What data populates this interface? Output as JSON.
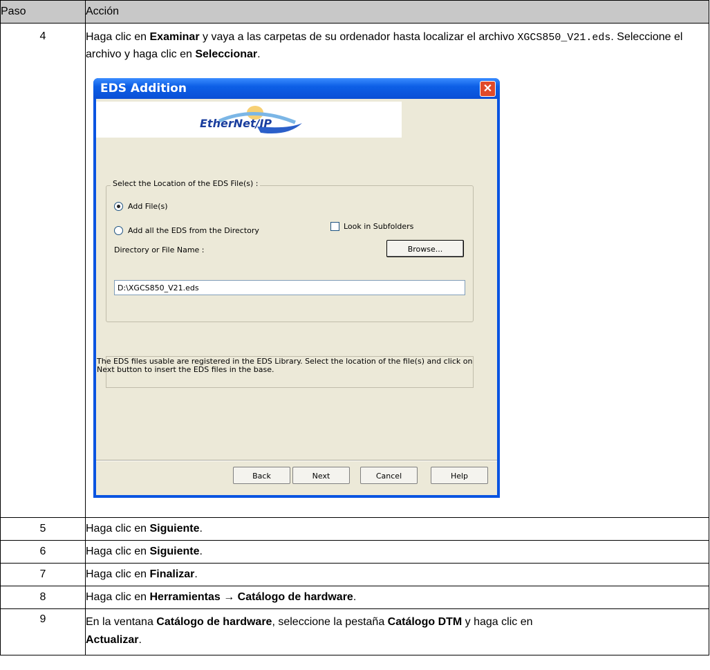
{
  "table": {
    "header": {
      "col1": "Paso",
      "col2": "Acción"
    },
    "row4": {
      "num": "4",
      "pre": "Haga clic en ",
      "b1": "Examinar",
      "mid": " y vaya a las carpetas de su ordenador hasta localizar el archivo ",
      "file": "XGCS850_V21.eds",
      "mid2": ". Seleccione el archivo y haga clic en ",
      "b2": "Seleccionar",
      "end": "."
    },
    "steps": [
      {
        "num": "5",
        "pre": "Haga clic en ",
        "bold": "Siguiente",
        "post": "."
      },
      {
        "num": "6",
        "pre": "Haga clic en ",
        "bold": "Siguiente",
        "post": "."
      },
      {
        "num": "7",
        "pre": "Haga clic en ",
        "bold": "Finalizar",
        "post": "."
      },
      {
        "num": "8",
        "pre": "Haga clic en ",
        "bold": "Herramientas → Catálogo de hardware",
        "post": "."
      }
    ],
    "row9": {
      "num": "9",
      "pre": "En la ventana ",
      "b1": "Catálogo de hardware",
      "mid": ", seleccione la pestaña ",
      "b2": "Catálogo DTM",
      "mid2": " y haga clic en ",
      "b3": "Actualizar",
      "end": "."
    }
  },
  "dialog": {
    "title": "EDS Addition",
    "close_symbol": "✕",
    "logo_text": "EtherNet/IP",
    "group_label": "Select the Location of the EDS File(s) :",
    "radio_add_files": "Add File(s)",
    "radio_add_dir": "Add all the EDS from the Directory",
    "checkbox_subfolders": "Look in Subfolders",
    "dir_label": "Directory or File Name :",
    "browse_label": "Browse...",
    "file_value": "D:\\XGCS850_V21.eds",
    "info_text": "The EDS files usable are registered in the EDS Library. Select the location of the file(s) and click on Next button to insert the EDS files in the base.",
    "buttons": {
      "back": "Back",
      "next": "Next",
      "cancel": "Cancel",
      "help": "Help"
    },
    "state": {
      "add_files_selected": true,
      "subfolders_checked": false
    }
  }
}
